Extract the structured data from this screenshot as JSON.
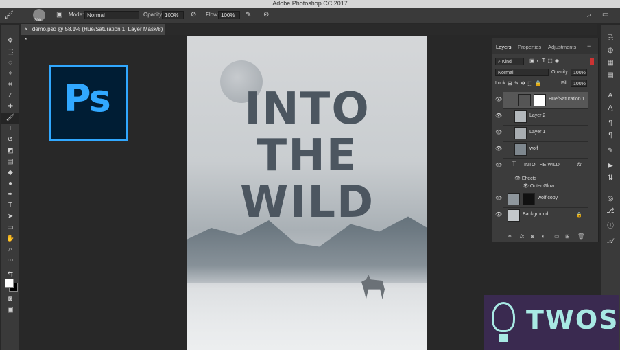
{
  "app": {
    "title": "Adobe Photoshop CC 2017"
  },
  "options_bar": {
    "brush_size": "300",
    "mode_label": "Mode:",
    "mode_value": "Normal",
    "opacity_label": "Opacity:",
    "opacity_value": "100%",
    "flow_label": "Flow:",
    "flow_value": "100%"
  },
  "document_tab": {
    "label": "demo.psd @ 58.1% (Hue/Saturation 1, Layer Mask/8) *"
  },
  "logo": {
    "text": "Ps",
    "color": "#31a8ff"
  },
  "poster": {
    "line1": "INTO",
    "line2": "THE",
    "line3": "WILD"
  },
  "layers_panel": {
    "tabs": [
      "Layers",
      "Properties",
      "Adjustments"
    ],
    "filter_label": "Kind",
    "blend_mode": "Normal",
    "opacity_label": "Opacity:",
    "opacity_value": "100%",
    "lock_label": "Lock:",
    "fill_label": "Fill:",
    "fill_value": "100%",
    "layers": [
      {
        "name": "Hue/Saturation 1"
      },
      {
        "name": "Layer 2"
      },
      {
        "name": "Layer 1"
      },
      {
        "name": "wolf"
      },
      {
        "name": "INTO THE WILD",
        "fx": "fx"
      },
      {
        "name": "Effects"
      },
      {
        "name": "Outer Glow"
      },
      {
        "name": "wolf copy"
      },
      {
        "name": "Background"
      }
    ]
  },
  "watermark": {
    "text": "TWOS"
  }
}
